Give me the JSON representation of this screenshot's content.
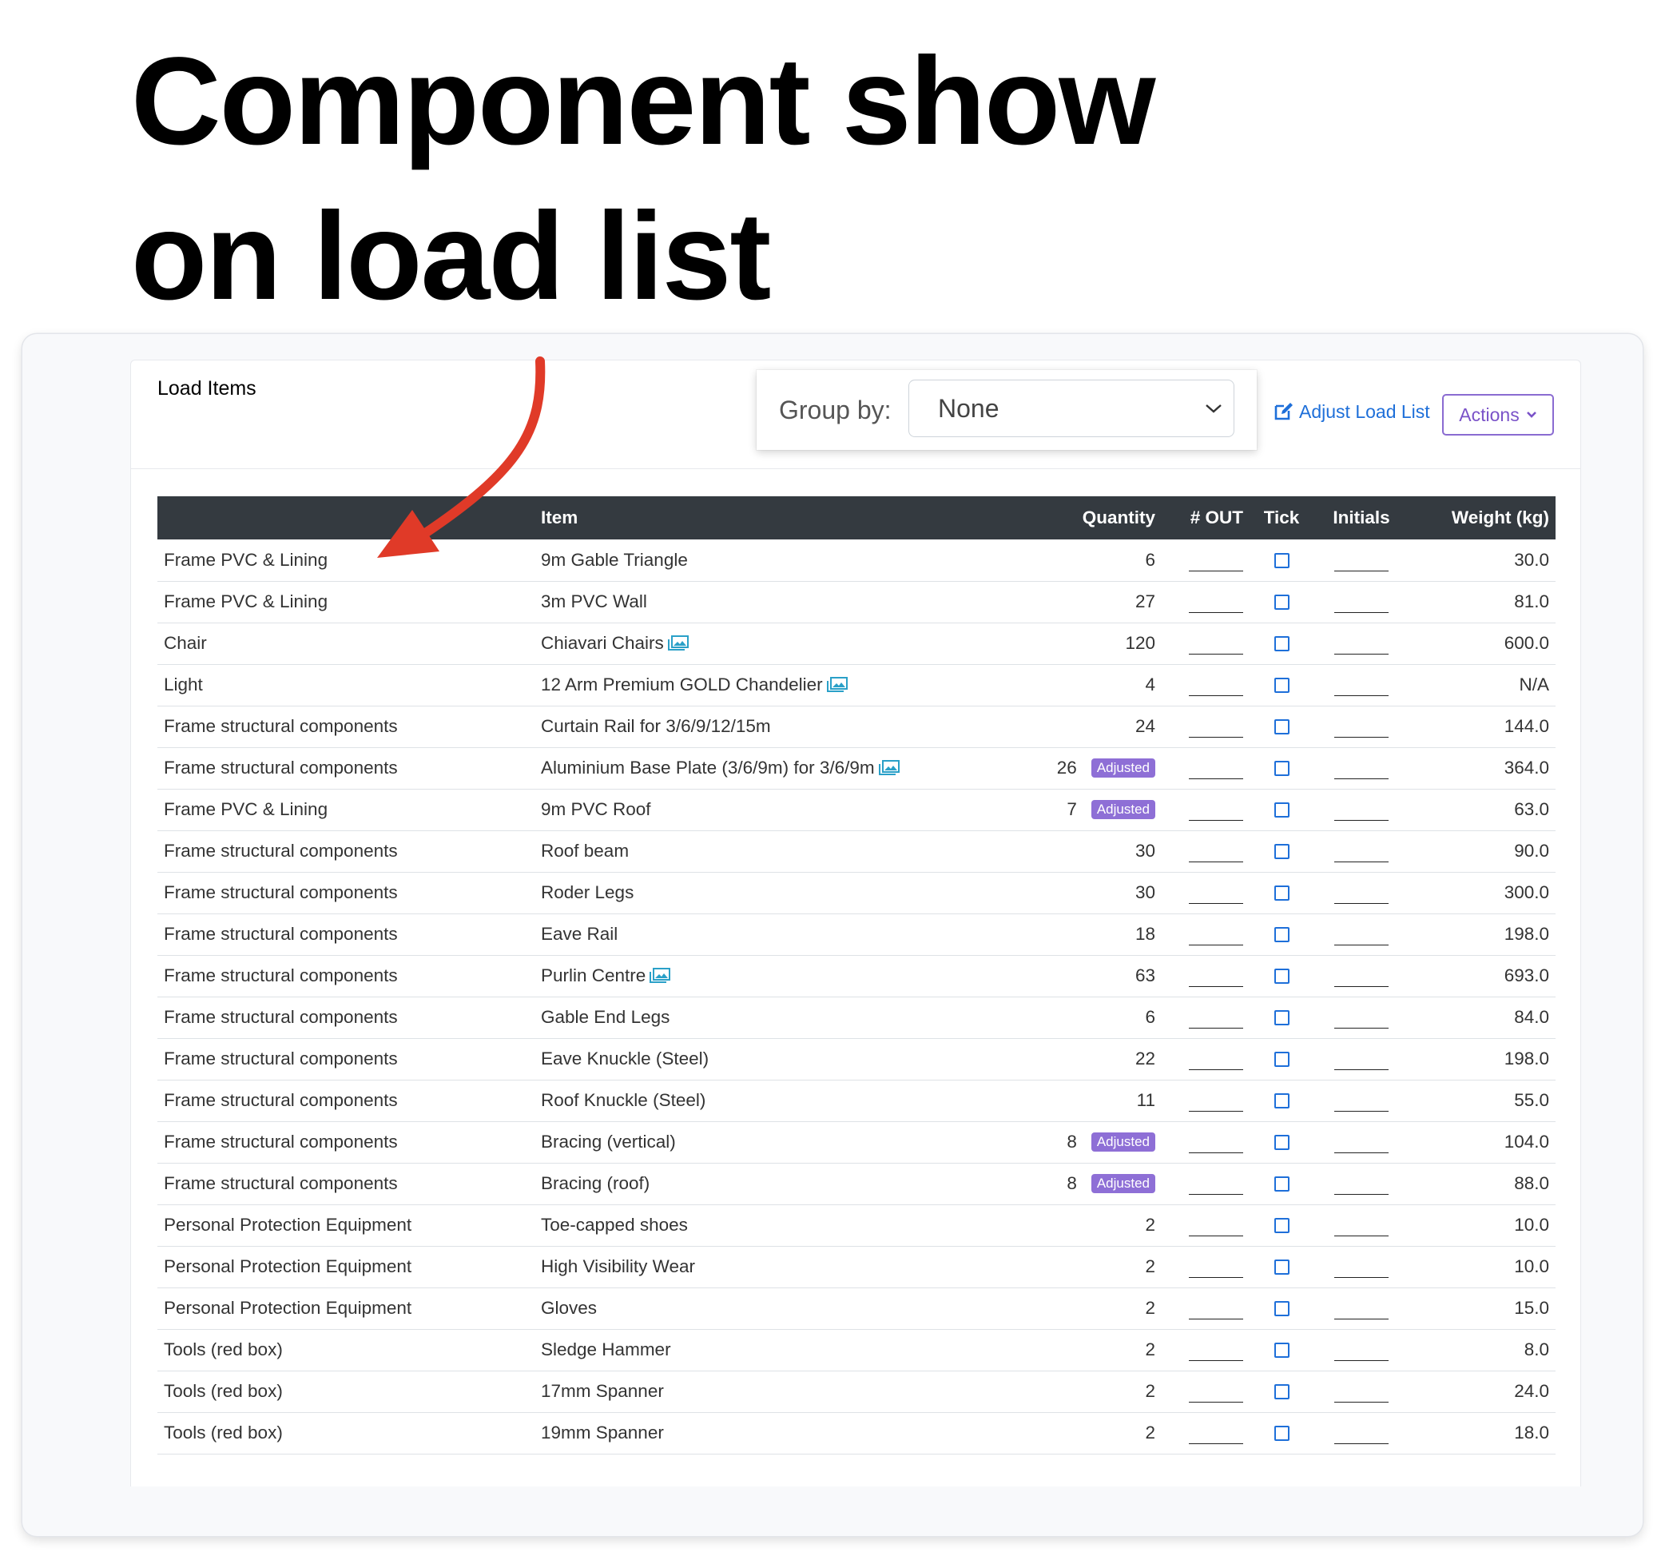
{
  "headline": {
    "line1": "Component show",
    "line2": "on load list"
  },
  "card": {
    "title": "Load Items"
  },
  "group_by": {
    "label": "Group by:",
    "value": "None"
  },
  "toolbar": {
    "adjust_label": "Adjust Load List",
    "actions_label": "Actions"
  },
  "colors": {
    "header_bg": "#343a40",
    "link_blue": "#1e6fd9",
    "badge_purple": "#8e6fd6",
    "arrow_red": "#e03a28"
  },
  "table": {
    "columns": [
      "",
      "Item",
      "Quantity",
      "# OUT",
      "Tick",
      "Initials",
      "Weight (kg)"
    ],
    "rows": [
      {
        "component": "Frame PVC & Lining",
        "item": "9m Gable Triangle",
        "has_image": false,
        "quantity": "6",
        "adjusted": "",
        "weight": "30.0"
      },
      {
        "component": "Frame PVC & Lining",
        "item": "3m PVC Wall",
        "has_image": false,
        "quantity": "27",
        "adjusted": "",
        "weight": "81.0"
      },
      {
        "component": "Chair",
        "item": "Chiavari Chairs",
        "has_image": true,
        "quantity": "120",
        "adjusted": "",
        "weight": "600.0"
      },
      {
        "component": "Light",
        "item": "12 Arm Premium GOLD Chandelier",
        "has_image": true,
        "quantity": "4",
        "adjusted": "",
        "weight": "N/A"
      },
      {
        "component": "Frame structural components",
        "item": "Curtain Rail for 3/6/9/12/15m",
        "has_image": false,
        "quantity": "24",
        "adjusted": "",
        "weight": "144.0"
      },
      {
        "component": "Frame structural components",
        "item": "Aluminium Base Plate (3/6/9m) for 3/6/9m",
        "has_image": true,
        "quantity": "26",
        "adjusted": "Adjusted",
        "weight": "364.0"
      },
      {
        "component": "Frame PVC & Lining",
        "item": "9m PVC Roof",
        "has_image": false,
        "quantity": "7",
        "adjusted": "Adjusted",
        "weight": "63.0"
      },
      {
        "component": "Frame structural components",
        "item": "Roof beam",
        "has_image": false,
        "quantity": "30",
        "adjusted": "",
        "weight": "90.0"
      },
      {
        "component": "Frame structural components",
        "item": "Roder Legs",
        "has_image": false,
        "quantity": "30",
        "adjusted": "",
        "weight": "300.0"
      },
      {
        "component": "Frame structural components",
        "item": "Eave Rail",
        "has_image": false,
        "quantity": "18",
        "adjusted": "",
        "weight": "198.0"
      },
      {
        "component": "Frame structural components",
        "item": "Purlin Centre",
        "has_image": true,
        "quantity": "63",
        "adjusted": "",
        "weight": "693.0"
      },
      {
        "component": "Frame structural components",
        "item": "Gable End Legs",
        "has_image": false,
        "quantity": "6",
        "adjusted": "",
        "weight": "84.0"
      },
      {
        "component": "Frame structural components",
        "item": "Eave Knuckle (Steel)",
        "has_image": false,
        "quantity": "22",
        "adjusted": "",
        "weight": "198.0"
      },
      {
        "component": "Frame structural components",
        "item": "Roof Knuckle (Steel)",
        "has_image": false,
        "quantity": "11",
        "adjusted": "",
        "weight": "55.0"
      },
      {
        "component": "Frame structural components",
        "item": "Bracing (vertical)",
        "has_image": false,
        "quantity": "8",
        "adjusted": "Adjusted",
        "weight": "104.0"
      },
      {
        "component": "Frame structural components",
        "item": "Bracing (roof)",
        "has_image": false,
        "quantity": "8",
        "adjusted": "Adjusted",
        "weight": "88.0"
      },
      {
        "component": "Personal Protection Equipment",
        "item": "Toe-capped shoes",
        "has_image": false,
        "quantity": "2",
        "adjusted": "",
        "weight": "10.0"
      },
      {
        "component": "Personal Protection Equipment",
        "item": "High Visibility Wear",
        "has_image": false,
        "quantity": "2",
        "adjusted": "",
        "weight": "10.0"
      },
      {
        "component": "Personal Protection Equipment",
        "item": "Gloves",
        "has_image": false,
        "quantity": "2",
        "adjusted": "",
        "weight": "15.0"
      },
      {
        "component": "Tools (red box)",
        "item": "Sledge Hammer",
        "has_image": false,
        "quantity": "2",
        "adjusted": "",
        "weight": "8.0"
      },
      {
        "component": "Tools (red box)",
        "item": "17mm Spanner",
        "has_image": false,
        "quantity": "2",
        "adjusted": "",
        "weight": "24.0"
      },
      {
        "component": "Tools (red box)",
        "item": "19mm Spanner",
        "has_image": false,
        "quantity": "2",
        "adjusted": "",
        "weight": "18.0"
      }
    ]
  }
}
